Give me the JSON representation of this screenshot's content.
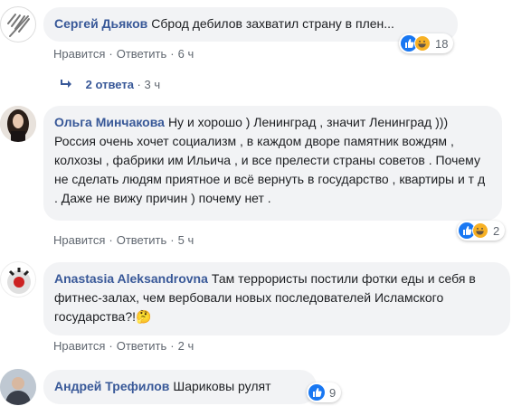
{
  "comments": [
    {
      "author": "Сергей Дьяков",
      "text": "Сброд дебилов захватил страну в плен...",
      "like_label": "Нравится",
      "reply_label": "Ответить",
      "time": "6 ч",
      "reactions": "18",
      "reaction_icons": [
        "like-icon",
        "haha-icon"
      ]
    },
    {
      "author": "Ольга Минчакова",
      "text": "Ну и хорошо ) Ленинград , значит Ленинград ))) Россия очень хочет социализм , в каждом дворе памятник вождям , колхозы , фабрики им Ильича , и все прелести страны советов . Почему не сделать людям приятное и всё вернуть в государство , квартиры и т д . Даже не вижу причин ) почему нет .",
      "like_label": "Нравится",
      "reply_label": "Ответить",
      "time": "5 ч",
      "reactions": "2",
      "reaction_icons": [
        "like-icon",
        "haha-icon"
      ]
    },
    {
      "author": "Anastasia Aleksandrovna",
      "text": "Там террористы постили фотки еды и себя в фитнес-залах, чем вербовали новых последователей Исламского государства?!",
      "emoji": "🤔",
      "like_label": "Нравится",
      "reply_label": "Ответить",
      "time": "2 ч",
      "reactions": "",
      "reaction_icons": []
    },
    {
      "author": "Андрей Трефилов",
      "text": "Шариковы рулят",
      "reactions": "9",
      "reaction_icons": [
        "like-icon"
      ]
    }
  ],
  "replies": {
    "label": "2 ответа",
    "time": "3 ч"
  },
  "colors": {
    "link": "#385898",
    "bubble": "#f2f3f5",
    "like": "#1877f2",
    "haha": "#f7b125",
    "meta": "#606770"
  }
}
